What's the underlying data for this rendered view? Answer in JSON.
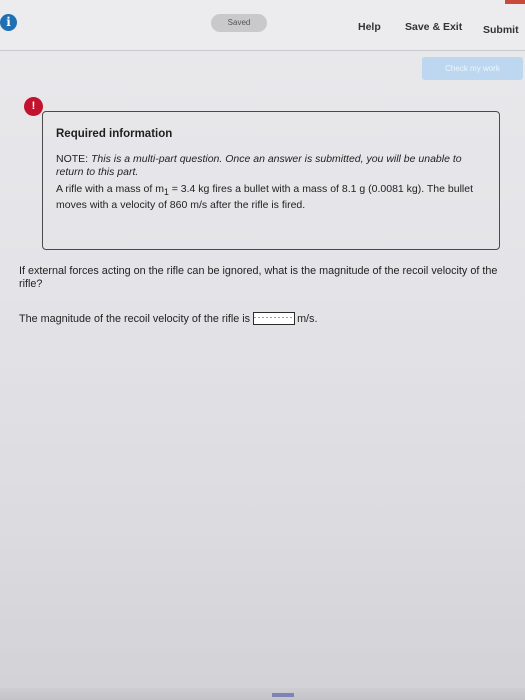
{
  "header": {
    "info_glyph": "i",
    "saved_label": "Saved",
    "help_label": "Help",
    "save_exit_label": "Save & Exit",
    "submit_label": "Submit"
  },
  "check_my_work_label": "Check my work",
  "required_info": {
    "badge": "!",
    "title": "Required information",
    "note_label": "NOTE:",
    "note_text": "This is a multi-part question. Once an answer is submitted, you will be unable to return to this part.",
    "problem_text_1": "A rifle with a mass of m",
    "problem_subscript": "1",
    "problem_text_2": " = 3.4 kg fires a bullet with a mass of 8.1 g (0.0081 kg). The bullet moves with a velocity of 860 m/s after the rifle is fired."
  },
  "question": {
    "prompt": "If external forces acting on the rifle can be ignored, what is the magnitude of the recoil velocity of the rifle?",
    "answer_prefix": "The magnitude of the recoil velocity of the rifle is",
    "answer_value": "",
    "answer_unit": "m/s."
  },
  "colors": {
    "info_icon": "#1f6fb5",
    "alert_badge": "#c2122e",
    "check_button": "#bcd7ef"
  }
}
